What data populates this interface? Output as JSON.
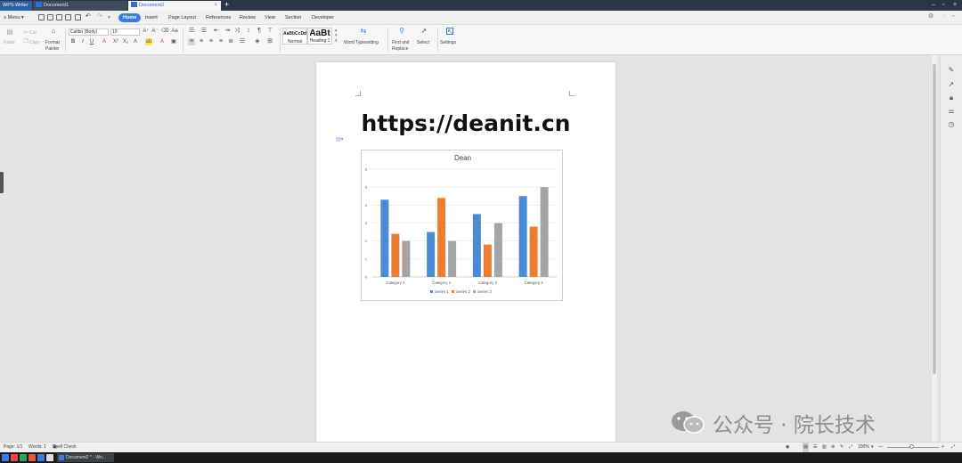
{
  "titlebar": {
    "app_name": "WPS Writer",
    "tabs": [
      {
        "label": "Document1"
      },
      {
        "label": "Document2"
      }
    ],
    "close_tab": "×",
    "new_tab": "+"
  },
  "menubar": {
    "menu_label": "Menu",
    "items": [
      {
        "label": "Home"
      },
      {
        "label": "Insert"
      },
      {
        "label": "Page Layout"
      },
      {
        "label": "References"
      },
      {
        "label": "Review"
      },
      {
        "label": "View"
      },
      {
        "label": "Section"
      },
      {
        "label": "Developer"
      }
    ]
  },
  "ribbon": {
    "paste": "Paste",
    "cut": "Cut",
    "copy": "Copy",
    "format_painter": [
      "Format",
      "Painter"
    ],
    "font_name": "Calibri (Body)",
    "font_size": "10",
    "styles": [
      {
        "preview": "AaBbCcDd",
        "name": "Normal"
      },
      {
        "preview": "AaBt",
        "name": "Heading 1"
      }
    ],
    "word_typesetting": "Word Typesetting",
    "find_replace": [
      "Find and",
      "Replace"
    ],
    "select": "Select",
    "settings": "Settings"
  },
  "document": {
    "url_text": "https://deanit.cn"
  },
  "chart_data": {
    "type": "bar",
    "title": "Dean",
    "categories": [
      "Category 1",
      "Category 2",
      "Category 3",
      "Category 4"
    ],
    "series": [
      {
        "name": "Series 1",
        "color": "#4a8bd4",
        "values": [
          4.3,
          2.5,
          3.5,
          4.5
        ]
      },
      {
        "name": "Series 2",
        "color": "#ed7d31",
        "values": [
          2.4,
          4.4,
          1.8,
          2.8
        ]
      },
      {
        "name": "Series 3",
        "color": "#a5a5a5",
        "values": [
          2,
          2,
          3,
          5
        ]
      }
    ],
    "yticks": [
      "0",
      "1",
      "2",
      "3",
      "4",
      "5",
      "6"
    ],
    "ylim": [
      0,
      6
    ],
    "grid": true,
    "legend": "bottom"
  },
  "status": {
    "page": "Page: 1/1",
    "words": "Words: 1",
    "spell": "Spell Check",
    "zoom": "100%"
  },
  "taskbar": {
    "doc_label": "Document2 * - Wri..."
  },
  "watermark": {
    "text": "公众号 · 院长技术"
  }
}
